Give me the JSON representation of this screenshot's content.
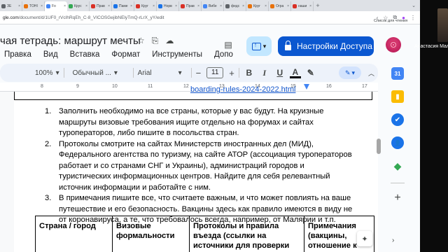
{
  "browser": {
    "tabs": [
      {
        "label": "ЗЕ",
        "color": "#5f6368"
      },
      {
        "label": "TOHI",
        "color": "#e8710a"
      },
      {
        "label": "Fo",
        "color": "#4285f4",
        "active": true
      },
      {
        "label": "Крус",
        "color": "#34a853"
      },
      {
        "label": "Прав",
        "color": "#d93025"
      },
      {
        "label": "Паме",
        "color": "#1a73e8"
      },
      {
        "label": "Круг",
        "color": "#d93025"
      },
      {
        "label": "Норв",
        "color": "#1a73e8"
      },
      {
        "label": "Прав",
        "color": "#d93025"
      },
      {
        "label": "Вибе",
        "color": "#4285f4"
      },
      {
        "label": "федс",
        "color": "#5f6368"
      },
      {
        "label": "Круг",
        "color": "#e8710a"
      },
      {
        "label": "Огра",
        "color": "#e8710a"
      },
      {
        "label": "наши",
        "color": "#d93025"
      }
    ],
    "url_host": "gle.com",
    "url_path": "/document/d/1UF0_rVcIhRqEh_C-8_VICOSGejibNElyTmQ-rLrX_yY/edit",
    "reading_list": "Список для чтения"
  },
  "video": {
    "name": "Анастасия Мали"
  },
  "doc": {
    "title": "чая тетрадь: маршрут мечты",
    "menu": [
      "Правка",
      "Вид",
      "Вставка",
      "Формат",
      "Инструменты",
      "Допо"
    ],
    "share_label": "Настройки Доступа"
  },
  "toolbar": {
    "zoom": "100%",
    "style": "Обычный ...",
    "font": "Arial",
    "size": "11",
    "minus": "−",
    "plus": "+",
    "bold": "B",
    "italic": "I",
    "underline": "U",
    "text_color": "A",
    "highlight": "✎",
    "edit_mode_icon": "✎",
    "undo_icon": "↶",
    "dropdown_chevron": "▾",
    "collapse_chevron": "︿"
  },
  "ruler": {
    "numbers": [
      "8",
      "9",
      "10",
      "11",
      "12",
      "13",
      "14",
      "15",
      "16",
      "17"
    ]
  },
  "prev_table_link": "boarding-rules-2024-2022.html",
  "list": [
    {
      "num": "1.",
      "text": "Заполнить необходимо на все страны, которые у вас будут. На круизные маршруты визовые требования ищите отдельно на форумах и сайтах туроператоров, либо пишите в посольства стран."
    },
    {
      "num": "2.",
      "text": "Протоколы смотрите на сайтах Министерств иностранных дел (МИД), Федерального агентства по туризму, на сайте АТОР (ассоциация туроператоров работает и со странами СНГ и Украины), администраций городов и туристических информационных центров. Найдите для себя релевантный источник информации и работайте с ним."
    },
    {
      "num": "3.",
      "text": "В примечания пишите все, что считаете важным, и что может повлиять на ваше путешествие и его безопасность. Вакцины здесь как правило имеются в виду не от коронавируса, а те, что требовалось всегда, например, от Малярии и т.п."
    }
  ],
  "table_headers": [
    "Страна / город",
    "Визовые формальности",
    "Протоколы и правила въезда (ссылки на источники для проверки",
    "Примечания (вакцины, отношение к"
  ],
  "icons": {
    "star": "☆",
    "folder": "⎘",
    "cloud": "☁",
    "comments": "▤",
    "move": "⇪",
    "back": "‹",
    "bookmark_star": "☆",
    "extension": "⧉",
    "profile": "●",
    "menu": "⋮",
    "calendar": "31",
    "keep": "▮",
    "tasks": "✔",
    "contacts": "👤",
    "maps": "◆",
    "plus": "+",
    "explore": "✦",
    "chevron": "›"
  },
  "colors": {
    "share_bg": "#0b57d0",
    "move_bg": "#c2e7ff",
    "toolbar_bg": "#edf2fa",
    "calendar": "#4285f4",
    "keep": "#fbbc04",
    "tasks": "#1a73e8",
    "contacts": "#1a73e8",
    "maps": "#34a853"
  }
}
